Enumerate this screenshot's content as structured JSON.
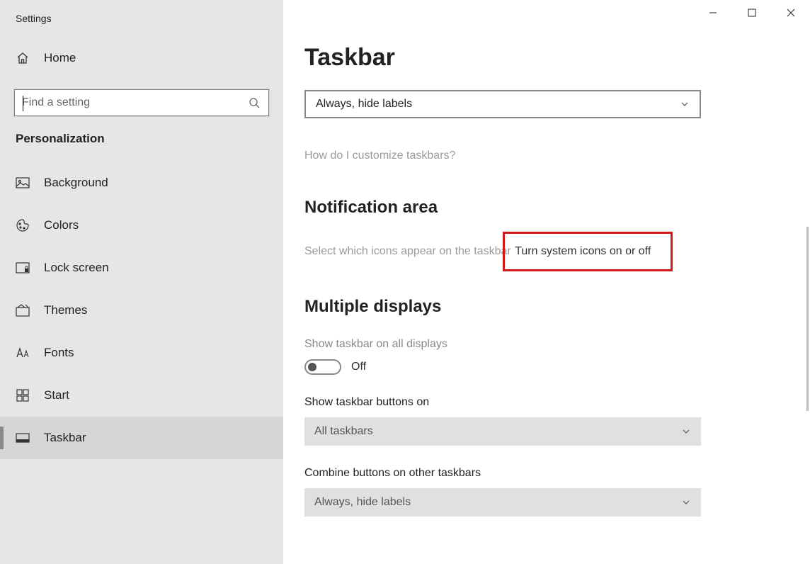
{
  "window": {
    "title": "Settings"
  },
  "sidebar": {
    "home": "Home",
    "search_placeholder": "Find a setting",
    "section": "Personalization",
    "items": [
      {
        "label": "Background"
      },
      {
        "label": "Colors"
      },
      {
        "label": "Lock screen"
      },
      {
        "label": "Themes"
      },
      {
        "label": "Fonts"
      },
      {
        "label": "Start"
      },
      {
        "label": "Taskbar"
      }
    ]
  },
  "content": {
    "page_title": "Taskbar",
    "dropdown1": "Always, hide labels",
    "help_link": "How do I customize taskbars?",
    "notif_heading": "Notification area",
    "notif_link1": "Select which icons appear on the taskbar",
    "notif_link2": "Turn system icons on or off",
    "multi_heading": "Multiple displays",
    "multi_toggle_label": "Show taskbar on all displays",
    "multi_toggle_state": "Off",
    "show_buttons_label": "Show taskbar buttons on",
    "show_buttons_value": "All taskbars",
    "combine_label": "Combine buttons on other taskbars",
    "combine_value": "Always, hide labels"
  }
}
